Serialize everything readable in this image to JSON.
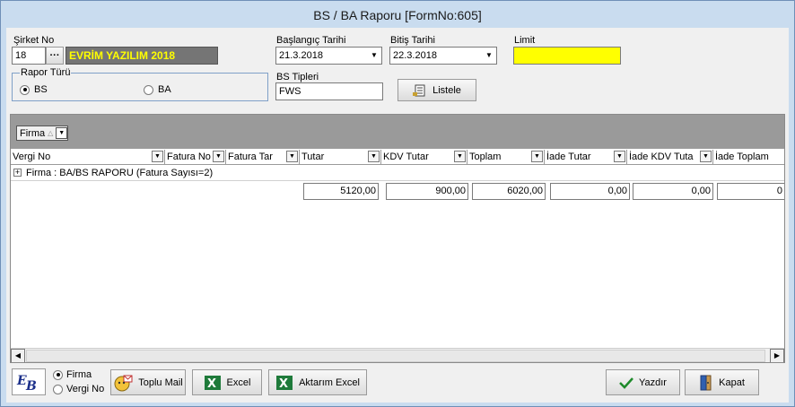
{
  "window": {
    "title": "BS / BA Raporu [FormNo:605]"
  },
  "filters": {
    "company_label": "Şirket No",
    "company_no": "18",
    "company_name": "EVRİM YAZILIM 2018",
    "browse_label": "···",
    "start_date_label": "Başlangıç Tarihi",
    "start_date": "21.3.2018",
    "end_date_label": "Bitiş Tarihi",
    "end_date": "22.3.2018",
    "limit_label": "Limit",
    "limit_value": "",
    "report_type_label": "Rapor Türü",
    "report_type_options": [
      "BS",
      "BA"
    ],
    "report_type_selected": "BS",
    "bs_types_label": "BS Tipleri",
    "bs_types_value": "FWS",
    "list_button": "Listele"
  },
  "grid": {
    "group_by_chip": "Firma",
    "columns": [
      "Vergi No",
      "Fatura No",
      "Fatura Tar",
      "Tutar",
      "KDV Tutar",
      "Toplam",
      "İade Tutar",
      "İade KDV Tuta",
      "İade Toplam"
    ],
    "group_row": "Firma : BA/BS RAPORU (Fatura Sayısı=2)",
    "summary": {
      "tutar": "5120,00",
      "kdv_tutar": "900,00",
      "toplam": "6020,00",
      "iade_tutar": "0,00",
      "iade_kdv": "0,00",
      "iade_toplam": "0"
    }
  },
  "footer": {
    "mode_options": [
      "Firma",
      "Vergi No"
    ],
    "mode_selected": "Firma",
    "bulk_mail": "Toplu Mail",
    "excel": "Excel",
    "transfer_excel": "Aktarım Excel",
    "print": "Yazdır",
    "close": "Kapat"
  },
  "colors": {
    "company_name_bg": "#757575",
    "company_name_fg": "#ffff00",
    "limit_bg": "#ffff00",
    "group_band": "#9a9a9a"
  }
}
